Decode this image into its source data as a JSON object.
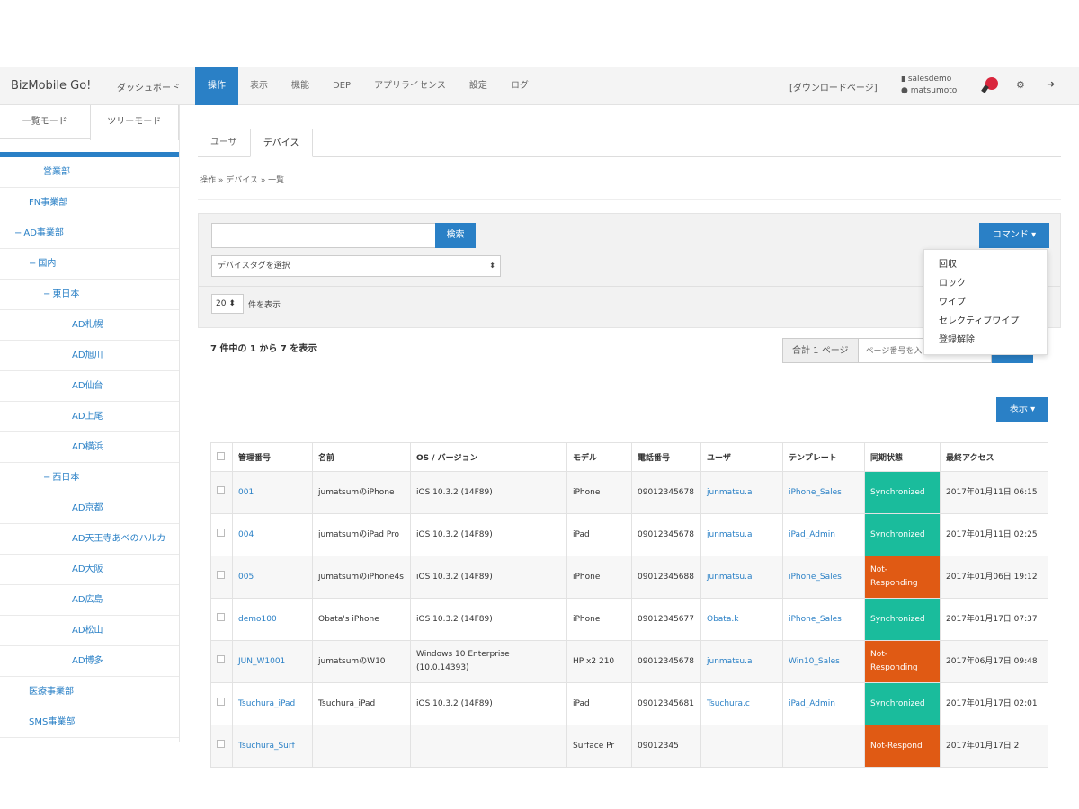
{
  "navbar": {
    "brand": "BizMobile Go!",
    "dashboard": "ダッシュボード",
    "tabs": [
      "操作",
      "表示",
      "機能",
      "DEP",
      "アプリライセンス",
      "設定",
      "ログ"
    ],
    "active_tab": 0,
    "download_page": "[ダウンロードページ]",
    "account_line1": "salesdemo",
    "account_line2": "matsumoto",
    "accent": "#2a80c6"
  },
  "sidebar": {
    "mode_tabs": [
      "一覧モード",
      "ツリーモード"
    ],
    "active_mode": 1,
    "items": [
      {
        "label": "営業部",
        "indent": 3
      },
      {
        "label": "FN事業部",
        "indent": 2
      },
      {
        "label": "AD事業部",
        "indent": 1,
        "toggle": "−"
      },
      {
        "label": "国内",
        "indent": 2,
        "toggle": "−"
      },
      {
        "label": "東日本",
        "indent": 3,
        "toggle": "−"
      },
      {
        "label": "AD札幌",
        "indent": 5
      },
      {
        "label": "AD旭川",
        "indent": 5
      },
      {
        "label": "AD仙台",
        "indent": 5
      },
      {
        "label": "AD上尾",
        "indent": 5
      },
      {
        "label": "AD横浜",
        "indent": 5
      },
      {
        "label": "西日本",
        "indent": 3,
        "toggle": "−"
      },
      {
        "label": "AD京都",
        "indent": 5
      },
      {
        "label": "AD天王寺あべのハルカ",
        "indent": 5
      },
      {
        "label": "AD大阪",
        "indent": 5
      },
      {
        "label": "AD広島",
        "indent": 5
      },
      {
        "label": "AD松山",
        "indent": 5
      },
      {
        "label": "AD博多",
        "indent": 5
      },
      {
        "label": "医療事業部",
        "indent": 2
      },
      {
        "label": "SMS事業部",
        "indent": 2
      }
    ]
  },
  "content": {
    "tabs": [
      "ユーザ",
      "デバイス"
    ],
    "active_tab": 1,
    "breadcrumb": "操作 » デバイス » 一覧",
    "search_button": "検索",
    "search_value": "",
    "tag_select": "デバイスタグを選択",
    "per_page_value": "20",
    "per_page_label": "件を表示",
    "command_button": "コマンド ▾",
    "command_menu": [
      "回収",
      "ロック",
      "ワイプ",
      "セレクティブワイプ",
      "登録解除"
    ],
    "showing": "7 件中の 1 から 7 を表示",
    "pager_total": "合計 1 ページ",
    "pager_placeholder": "ページ番号を入力",
    "columns_button": "表示 ▾"
  },
  "table": {
    "headers": [
      "",
      "管理番号",
      "名前",
      "OS / バージョン",
      "モデル",
      "電話番号",
      "ユーザ",
      "テンプレート",
      "同期状態",
      "最終アクセス"
    ],
    "rows": [
      {
        "id": "001",
        "name": "jumatsumのiPhone",
        "os": "iOS 10.3.2 (14F89)",
        "model": "iPhone",
        "phone": "09012345678",
        "user": "junmatsu.a",
        "template": "iPhone_Sales",
        "status": "Synchronized",
        "status_type": "sync",
        "last": "2017年01月11日 06:15"
      },
      {
        "id": "004",
        "name": "jumatsumのiPad Pro",
        "os": "iOS 10.3.2 (14F89)",
        "model": "iPad",
        "phone": "09012345678",
        "user": "junmatsu.a",
        "template": "iPad_Admin",
        "status": "Synchronized",
        "status_type": "sync",
        "last": "2017年01月11日 02:25"
      },
      {
        "id": "005",
        "name": "jumatsumのiPhone4s",
        "os": "iOS 10.3.2 (14F89)",
        "model": "iPhone",
        "phone": "09012345688",
        "user": "junmatsu.a",
        "template": "iPhone_Sales",
        "status": "Not-Responding",
        "status_type": "nr",
        "last": "2017年01月06日 19:12"
      },
      {
        "id": "demo100",
        "name": "Obata's iPhone",
        "os": "iOS 10.3.2 (14F89)",
        "model": "iPhone",
        "phone": "09012345677",
        "user": "Obata.k",
        "template": "iPhone_Sales",
        "status": "Synchronized",
        "status_type": "sync",
        "last": "2017年01月17日 07:37"
      },
      {
        "id": "JUN_W1001",
        "name": "jumatsumのW10",
        "os": "Windows 10 Enterprise (10.0.14393)",
        "model": "HP x2 210",
        "phone": "09012345678",
        "user": "junmatsu.a",
        "template": "Win10_Sales",
        "status": "Not-Responding",
        "status_type": "nr",
        "last": "2017年06月17日 09:48"
      },
      {
        "id": "Tsuchura_iPad",
        "name": "Tsuchura_iPad",
        "os": "iOS 10.3.2 (14F89)",
        "model": "iPad",
        "phone": "09012345681",
        "user": "Tsuchura.c",
        "template": "iPad_Admin",
        "status": "Synchronized",
        "status_type": "sync",
        "last": "2017年01月17日 02:01"
      },
      {
        "id": "Tsuchura_Surf",
        "name": "",
        "os": "",
        "model": "Surface Pr",
        "phone": "09012345",
        "user": "",
        "template": "",
        "status": "Not-Respond",
        "status_type": "nr",
        "last": "2017年01月17日 2"
      }
    ]
  }
}
